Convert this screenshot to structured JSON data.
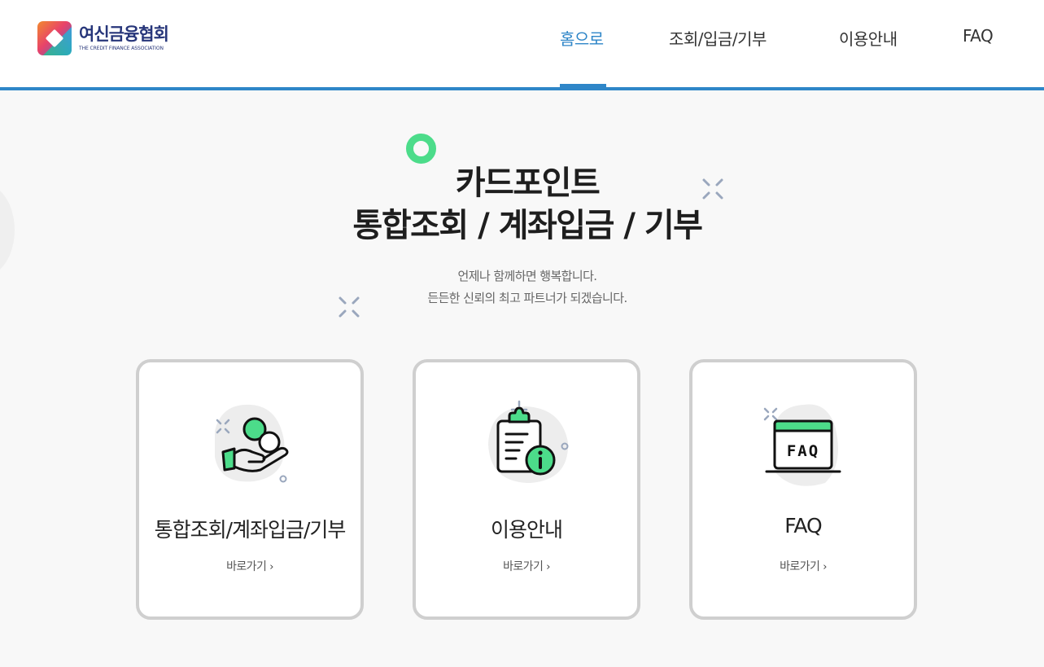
{
  "header": {
    "logo": {
      "name_ko": "여신금융협회",
      "name_en": "THE CREDIT FINANCE ASSOCIATION",
      "icon": "credit-finance-association-logo"
    },
    "nav": {
      "items": [
        {
          "label": "홈으로",
          "active": true
        },
        {
          "label": "조회/입금/기부",
          "active": false
        },
        {
          "label": "이용안내",
          "active": false
        },
        {
          "label": "FAQ",
          "active": false
        }
      ]
    }
  },
  "hero": {
    "title_line1": "카드포인트",
    "title_line2": "통합조회 / 계좌입금 / 기부",
    "subtitle_line1": "언제나 함께하면 행복합니다.",
    "subtitle_line2": "든든한 신뢰의 최고 파트너가 되겠습니다."
  },
  "cards": [
    {
      "title": "통합조회/계좌입금/기부",
      "link_label": "바로가기",
      "icon": "hand-coins-icon"
    },
    {
      "title": "이용안내",
      "link_label": "바로가기",
      "icon": "clipboard-info-icon"
    },
    {
      "title": "FAQ",
      "link_label": "바로가기",
      "icon": "faq-board-icon",
      "icon_text": "FAQ"
    }
  ],
  "colors": {
    "accent": "#2f86c8",
    "green": "#4cdc8a",
    "logo_navy": "#27367a"
  }
}
